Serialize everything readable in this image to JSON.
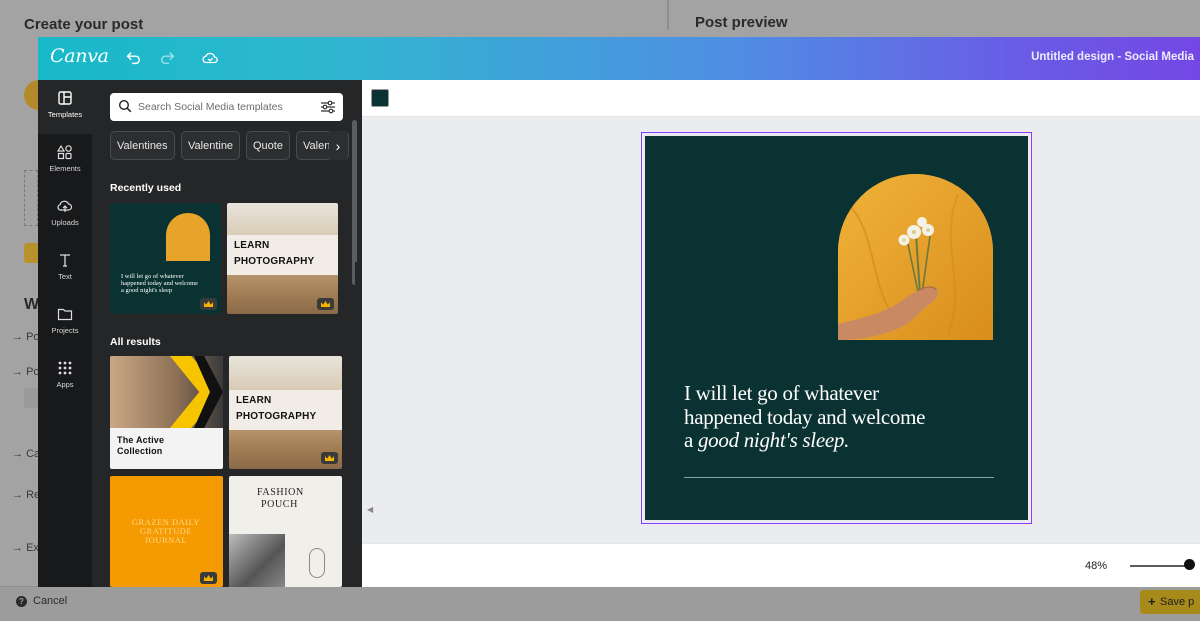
{
  "host": {
    "title": "Create your post",
    "preview_title": "Post preview",
    "fragments": [
      "W",
      "Po",
      "Po",
      "Ca",
      "Re",
      "Ex"
    ],
    "cancel_label": "Cancel",
    "save_label": "Save p"
  },
  "editor": {
    "logo": "Canva",
    "document_title": "Untitled design - Social Media",
    "rail": [
      {
        "label": "Templates",
        "icon": "templates-icon"
      },
      {
        "label": "Elements",
        "icon": "elements-icon"
      },
      {
        "label": "Uploads",
        "icon": "uploads-icon"
      },
      {
        "label": "Text",
        "icon": "text-icon"
      },
      {
        "label": "Projects",
        "icon": "projects-icon"
      },
      {
        "label": "Apps",
        "icon": "apps-icon"
      }
    ],
    "search": {
      "placeholder": "Search Social Media templates"
    },
    "chips": [
      "Valentines",
      "Valentine",
      "Quote",
      "Valentin"
    ],
    "recently_used_title": "Recently used",
    "all_results_title": "All results",
    "thumbs": {
      "quote_text": "I will let go of whatever happened today and welcome a good night's sleep",
      "learn_line1": "LEARN",
      "learn_line2": "PHOTOGRAPHY",
      "active_line1": "The Active",
      "active_line2": "Collection",
      "orange_text": "GRAZEN DAILY GRATITUDE JOURNAL",
      "fashion_line1": "FASHION",
      "fashion_line2": "POUCH"
    },
    "design": {
      "background_color": "#0b3232",
      "quote_line1": "I will let go of whatever",
      "quote_line2": "happened today and welcome",
      "quote_line3_prefix": "a ",
      "quote_line3_italic": "good night's sleep."
    },
    "zoom": "48%"
  }
}
